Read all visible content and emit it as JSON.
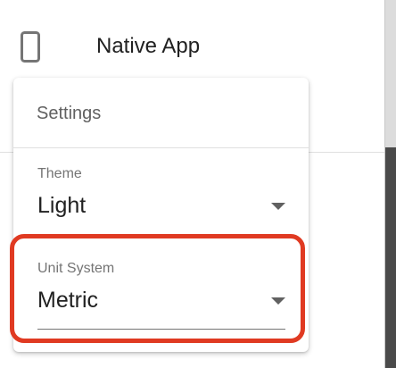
{
  "app": {
    "icon": "phone-icon",
    "label": "Native App"
  },
  "settings": {
    "title": "Settings",
    "theme": {
      "label": "Theme",
      "value": "Light"
    },
    "unit_system": {
      "label": "Unit System",
      "value": "Metric"
    }
  },
  "colors": {
    "highlight": "#e03a22",
    "text_primary": "#212121",
    "text_secondary": "#757575"
  }
}
